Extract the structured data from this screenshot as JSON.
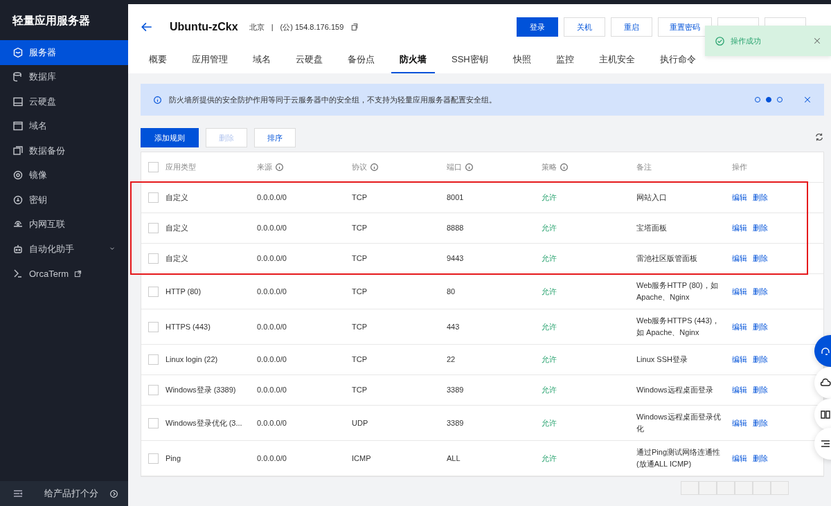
{
  "sidebar": {
    "title": "轻量应用服务器",
    "items": [
      {
        "label": "服务器",
        "selected": true,
        "kind": "plain"
      },
      {
        "label": "数据库",
        "selected": false,
        "kind": "plain"
      },
      {
        "label": "云硬盘",
        "selected": false,
        "kind": "plain"
      },
      {
        "label": "域名",
        "selected": false,
        "kind": "plain"
      },
      {
        "label": "数据备份",
        "selected": false,
        "kind": "plain"
      },
      {
        "label": "镜像",
        "selected": false,
        "kind": "plain"
      },
      {
        "label": "密钥",
        "selected": false,
        "kind": "plain"
      },
      {
        "label": "内网互联",
        "selected": false,
        "kind": "plain"
      },
      {
        "label": "自动化助手",
        "selected": false,
        "kind": "expandable"
      },
      {
        "label": "OrcaTerm",
        "selected": false,
        "kind": "external"
      }
    ],
    "feedback": "给产品打个分"
  },
  "header": {
    "title": "Ubuntu-zCkx",
    "region": "北京",
    "separator": "|",
    "ip": "(公) 154.8.176.159",
    "buttons": [
      {
        "label": "登录",
        "primary": true
      },
      {
        "label": "关机",
        "primary": false
      },
      {
        "label": "重启",
        "primary": false
      },
      {
        "label": "重置密码",
        "primary": false
      },
      {
        "primary": false
      },
      {
        "primary": false
      }
    ]
  },
  "tabs": [
    {
      "label": "概要",
      "selected": false
    },
    {
      "label": "应用管理",
      "selected": false
    },
    {
      "label": "域名",
      "selected": false
    },
    {
      "label": "云硬盘",
      "selected": false
    },
    {
      "label": "备份点",
      "selected": false
    },
    {
      "label": "防火墙",
      "selected": true
    },
    {
      "label": "SSH密钥",
      "selected": false
    },
    {
      "label": "快照",
      "selected": false
    },
    {
      "label": "监控",
      "selected": false
    },
    {
      "label": "主机安全",
      "selected": false
    },
    {
      "label": "执行命令",
      "selected": false
    }
  ],
  "toast": {
    "message": "操作成功"
  },
  "banner": {
    "text": "防火墙所提供的安全防护作用等同于云服务器中的安全组，不支持为轻量应用服务器配置安全组。",
    "dots": [
      {
        "selected": false
      },
      {
        "selected": true
      },
      {
        "selected": false
      }
    ]
  },
  "toolbar": {
    "buttons": [
      {
        "label": "添加规则",
        "kind": "primary",
        "disabled": false
      },
      {
        "label": "删除",
        "kind": "default",
        "disabled": true
      },
      {
        "label": "排序",
        "kind": "default",
        "disabled": false
      }
    ]
  },
  "table": {
    "select_all_checked": false,
    "columns": [
      {
        "label": "应用类型",
        "info": false
      },
      {
        "label": "来源",
        "info": true
      },
      {
        "label": "协议",
        "info": true
      },
      {
        "label": "端口",
        "info": true
      },
      {
        "label": "策略",
        "info": true
      },
      {
        "label": "备注",
        "info": false
      },
      {
        "label": "操作",
        "info": false
      }
    ],
    "rows": [
      {
        "type": "自定义",
        "source": "0.0.0.0/0",
        "protocol": "TCP",
        "port": "8001",
        "policy": "允许",
        "note": "网站入口",
        "actions": [
          "编辑",
          "删除"
        ],
        "checked": false,
        "highlighted": true
      },
      {
        "type": "自定义",
        "source": "0.0.0.0/0",
        "protocol": "TCP",
        "port": "8888",
        "policy": "允许",
        "note": "宝塔面板",
        "actions": [
          "编辑",
          "删除"
        ],
        "checked": false,
        "highlighted": true
      },
      {
        "type": "自定义",
        "source": "0.0.0.0/0",
        "protocol": "TCP",
        "port": "9443",
        "policy": "允许",
        "note": "雷池社区版管面板",
        "actions": [
          "编辑",
          "删除"
        ],
        "checked": false,
        "highlighted": true
      },
      {
        "type": "HTTP (80)",
        "source": "0.0.0.0/0",
        "protocol": "TCP",
        "port": "80",
        "policy": "允许",
        "note": "Web服务HTTP (80)，如 Apache、Nginx",
        "actions": [
          "编辑",
          "删除"
        ],
        "checked": false,
        "highlighted": false
      },
      {
        "type": "HTTPS (443)",
        "source": "0.0.0.0/0",
        "protocol": "TCP",
        "port": "443",
        "policy": "允许",
        "note": "Web服务HTTPS (443)，如 Apache、Nginx",
        "actions": [
          "编辑",
          "删除"
        ],
        "checked": false,
        "highlighted": false
      },
      {
        "type": "Linux login (22)",
        "source": "0.0.0.0/0",
        "protocol": "TCP",
        "port": "22",
        "policy": "允许",
        "note": "Linux SSH登录",
        "actions": [
          "编辑",
          "删除"
        ],
        "checked": false,
        "highlighted": false
      },
      {
        "type": "Windows登录 (3389)",
        "source": "0.0.0.0/0",
        "protocol": "TCP",
        "port": "3389",
        "policy": "允许",
        "note": "Windows远程桌面登录",
        "actions": [
          "编辑",
          "删除"
        ],
        "checked": false,
        "highlighted": false
      },
      {
        "type": "Windows登录优化 (3...",
        "source": "0.0.0.0/0",
        "protocol": "UDP",
        "port": "3389",
        "policy": "允许",
        "note": "Windows远程桌面登录优化",
        "actions": [
          "编辑",
          "删除"
        ],
        "checked": false,
        "highlighted": false
      },
      {
        "type": "Ping",
        "source": "0.0.0.0/0",
        "protocol": "ICMP",
        "port": "ALL",
        "policy": "允许",
        "note": "通过Ping测试网络连通性 (放通ALL ICMP)",
        "actions": [
          "编辑",
          "删除"
        ],
        "checked": false,
        "highlighted": false
      }
    ]
  }
}
